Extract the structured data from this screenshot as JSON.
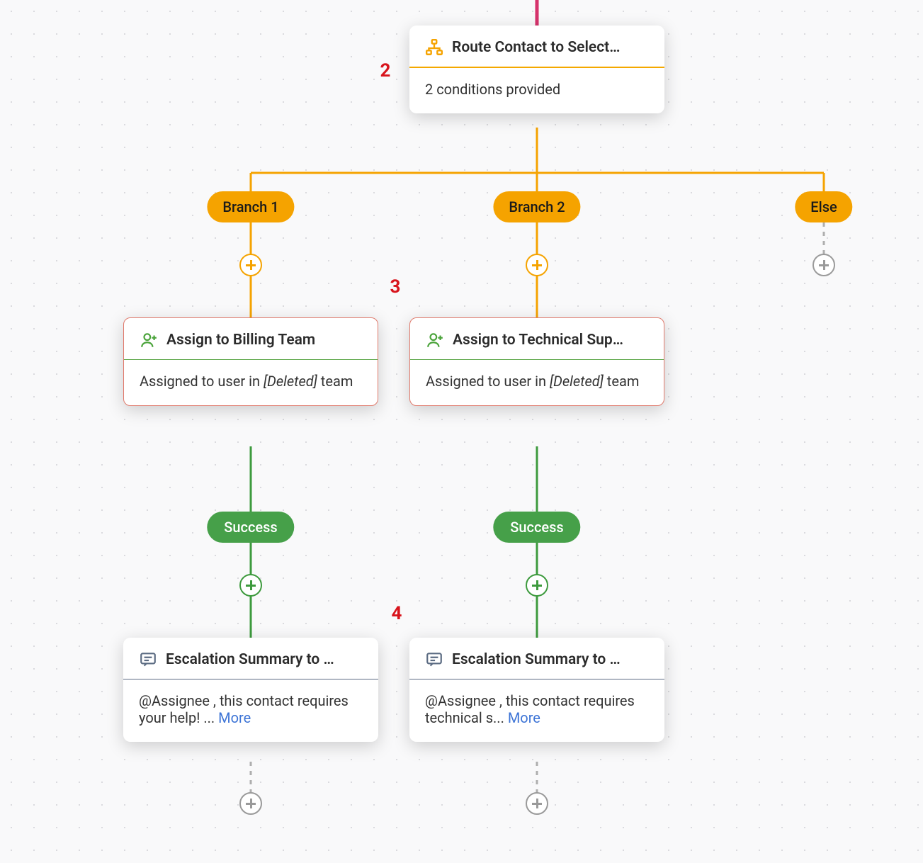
{
  "steps": {
    "s2": "2",
    "s3": "3",
    "s4": "4"
  },
  "route_node": {
    "title": "Route Contact to Select…",
    "body": "2 conditions provided"
  },
  "branches": {
    "b1_label": "Branch 1",
    "b2_label": "Branch 2",
    "else_label": "Else"
  },
  "assign1": {
    "title": "Assign to Billing Team",
    "prefix": "Assigned to user in ",
    "deleted": "[Deleted]",
    "suffix": " team"
  },
  "assign2": {
    "title": "Assign to Technical Sup…",
    "prefix": "Assigned to user in ",
    "deleted": "[Deleted]",
    "suffix": " team"
  },
  "success_label": "Success",
  "summary1": {
    "title": "Escalation Summary to …",
    "body": "@Assignee , this contact requires your help! ... ",
    "more": "More"
  },
  "summary2": {
    "title": "Escalation Summary to …",
    "body": "@Assignee , this contact requires technical s... ",
    "more": "More"
  }
}
